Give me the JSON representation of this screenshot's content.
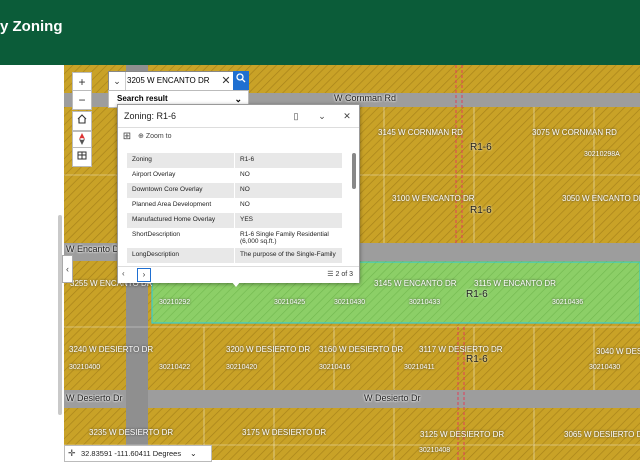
{
  "banner": {
    "title": "y Zoning",
    "bg": "#0b5c39"
  },
  "search": {
    "value": "3205 W ENCANTO DR",
    "placeholder": "",
    "result_label": "Search result",
    "icons": {
      "dropdown": "chevron-down-icon",
      "clear": "close-icon",
      "go": "search-icon"
    }
  },
  "map_controls": {
    "zoom_in": "+",
    "zoom_out": "−",
    "home": "home-icon",
    "compass": "compass-icon",
    "basemap": "basemap-icon"
  },
  "popup": {
    "title": "Zoning: R1-6",
    "zoom_to": "Zoom to",
    "rows": [
      {
        "key": "Zoning",
        "value": "R1-6"
      },
      {
        "key": "Airport Overlay",
        "value": "NO"
      },
      {
        "key": "Downtown Core Overlay",
        "value": "NO"
      },
      {
        "key": "Planned Area Development",
        "value": "NO"
      },
      {
        "key": "Manufactured Home Overlay",
        "value": "YES"
      },
      {
        "key": "ShortDescription",
        "value": "R1-6 Single Family Residential (6,000 sq.ft.)"
      },
      {
        "key": "LongDescription",
        "value": "The purpose of the Single-Family"
      }
    ],
    "count": "2 of 3"
  },
  "map": {
    "streets": [
      "W Cornman Rd",
      "W Encanto Dr",
      "W Desierto Dr"
    ],
    "addresses": [
      "3145 W CORNMAN RD",
      "3075 W CORNMAN RD",
      "3100 W ENCANTO DR",
      "3050 W ENCANTO DR",
      "3255 W ENCANTO DR",
      "3145 W ENCANTO DR",
      "3115 W ENCANTO DR",
      "3240 W DESIERTO DR",
      "3200 W DESIERTO DR",
      "3160 W DESIERTO DR",
      "3117 W DESIERTO DR",
      "3040 W DESIERTO DR",
      "3235 W DESIERTO DR",
      "3175 W DESIERTO DR",
      "3125 W DESIERTO DR",
      "3065 W DESIERTO DR"
    ],
    "zones": [
      "R1-6",
      "R1-6",
      "R1-6",
      "R1-6"
    ],
    "parcels": [
      "30210298A",
      "30210292",
      "30210425",
      "30210430",
      "30210433",
      "30210422",
      "30210420",
      "30210416",
      "30210411",
      "30210436",
      "30210430",
      "30210400",
      "30210408"
    ],
    "colors": {
      "zone_fill": "#c9a227",
      "selected": "#7fd36b",
      "road": "#9a9a9a"
    }
  },
  "coords": {
    "text": "32.83591 -111.60411 Degrees",
    "unit_icon": "chevron-down-icon"
  }
}
